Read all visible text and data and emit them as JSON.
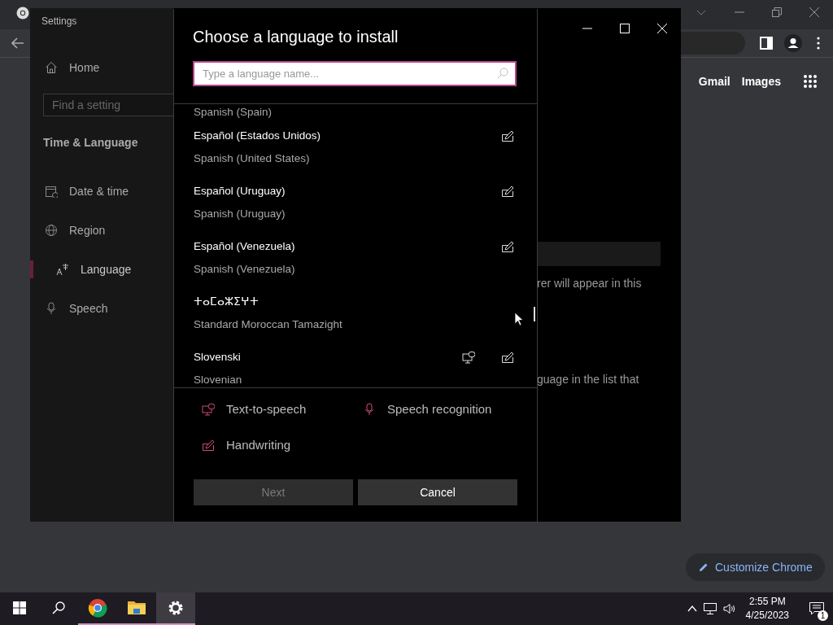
{
  "browser": {
    "links": [
      "Gmail",
      "Images"
    ],
    "customize_button": "Customize Chrome"
  },
  "settings": {
    "title": "Settings",
    "home": "Home",
    "search": {
      "placeholder": "Find a setting"
    },
    "section": "Time & Language",
    "nav": [
      {
        "kind": "calendar",
        "label": "Date & time",
        "selected": false
      },
      {
        "kind": "globe",
        "label": "Region",
        "selected": false
      },
      {
        "kind": "language",
        "label": "Language",
        "selected": true
      },
      {
        "kind": "microphone",
        "label": "Speech",
        "selected": false
      }
    ],
    "background_texts": [
      "rer will appear in this",
      "guage in the list that"
    ]
  },
  "dialog": {
    "title": "Choose a language to install",
    "search": {
      "placeholder": "Type a language name..."
    },
    "languages": [
      {
        "english": "Spanish (Spain)"
      },
      {
        "name": "Español (Estados Unidos)",
        "english": "Spanish (United States)",
        "text_to_speech": false,
        "handwriting": true
      },
      {
        "name": "Español (Uruguay)",
        "english": "Spanish (Uruguay)",
        "text_to_speech": false,
        "handwriting": true
      },
      {
        "name": "Español (Venezuela)",
        "english": "Spanish (Venezuela)",
        "text_to_speech": false,
        "handwriting": true
      },
      {
        "name": "ⵜⴰⵎⴰⵣⵉⵖⵜ",
        "english": "Standard Moroccan Tamazight",
        "text_to_speech": false,
        "handwriting": false
      },
      {
        "name": "Slovenski",
        "english": "Slovenian",
        "text_to_speech": true,
        "handwriting": true
      }
    ],
    "legend": [
      {
        "kind": "text-to-speech",
        "label": "Text-to-speech"
      },
      {
        "kind": "speech-recognition",
        "label": "Speech recognition"
      },
      {
        "kind": "handwriting",
        "label": "Handwriting"
      }
    ],
    "buttons": [
      {
        "label": "Next",
        "disabled": true
      },
      {
        "label": "Cancel",
        "disabled": false
      }
    ]
  },
  "taskbar": {
    "apps": [
      {
        "kind": "chrome",
        "running": true,
        "active": false
      },
      {
        "kind": "folder",
        "running": true,
        "active": false
      },
      {
        "kind": "settings",
        "running": true,
        "active": true
      }
    ],
    "time": "2:55 PM",
    "date": "4/25/2023",
    "notifications": "1"
  }
}
